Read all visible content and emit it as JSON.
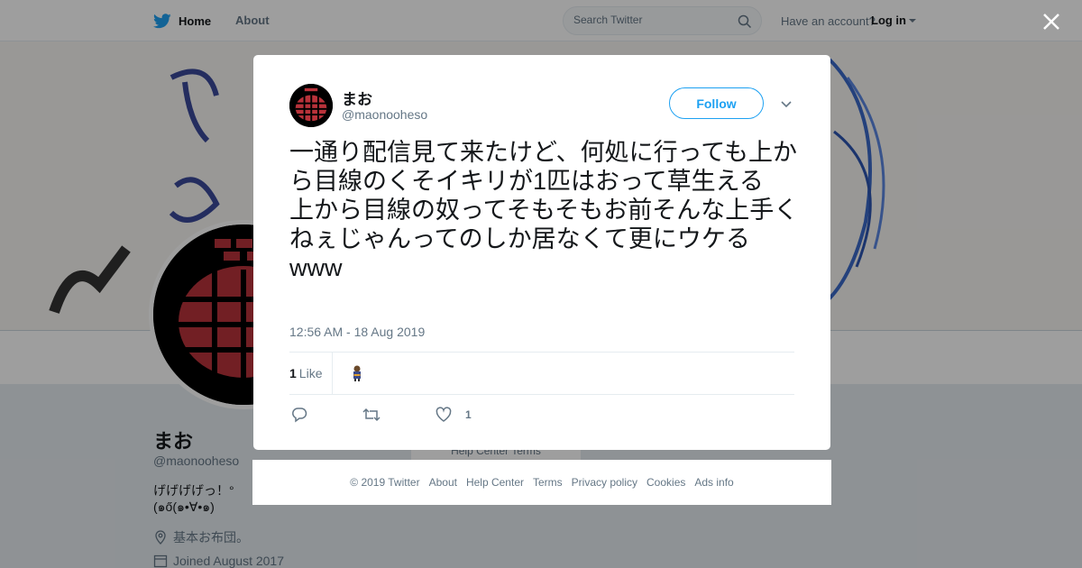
{
  "topbar": {
    "home_label": "Home",
    "about_label": "About",
    "search_placeholder": "Search Twitter",
    "have_account": "Have an account?",
    "login_label": "Log in"
  },
  "profile": {
    "name": "まお",
    "handle": "@maonooheso",
    "bio": "げげげげっ！°(๑ő(๑•∀•๑)",
    "location": "基本お布団。",
    "joined": "Joined August 2017",
    "help_links": "Help Center   Terms"
  },
  "tweet": {
    "author_name": "まお",
    "author_handle": "@maonooheso",
    "follow_label": "Follow",
    "text": "一通り配信見て来たけど、何処に行っても上から目線のくそイキリが1匹はおって草生える\n上から目線の奴ってそもそもお前そんな上手くねぇじゃんってのしか居なくて更にウケるwww",
    "timestamp": "12:56 AM - 18 Aug 2019",
    "like_count": "1",
    "like_label": "Like",
    "action_like_count": "1"
  },
  "footer": {
    "copyright": "© 2019 Twitter",
    "links": [
      "About",
      "Help Center",
      "Terms",
      "Privacy policy",
      "Cookies",
      "Ads info"
    ]
  },
  "colors": {
    "accent": "#1da1f2",
    "text": "#14171a",
    "muted": "#657786",
    "avatar_red": "#b8323a"
  },
  "icons": [
    "twitter-bird-icon",
    "search-icon",
    "close-icon",
    "chevron-down-icon",
    "reply-icon",
    "retweet-icon",
    "heart-icon",
    "location-icon",
    "calendar-icon"
  ]
}
